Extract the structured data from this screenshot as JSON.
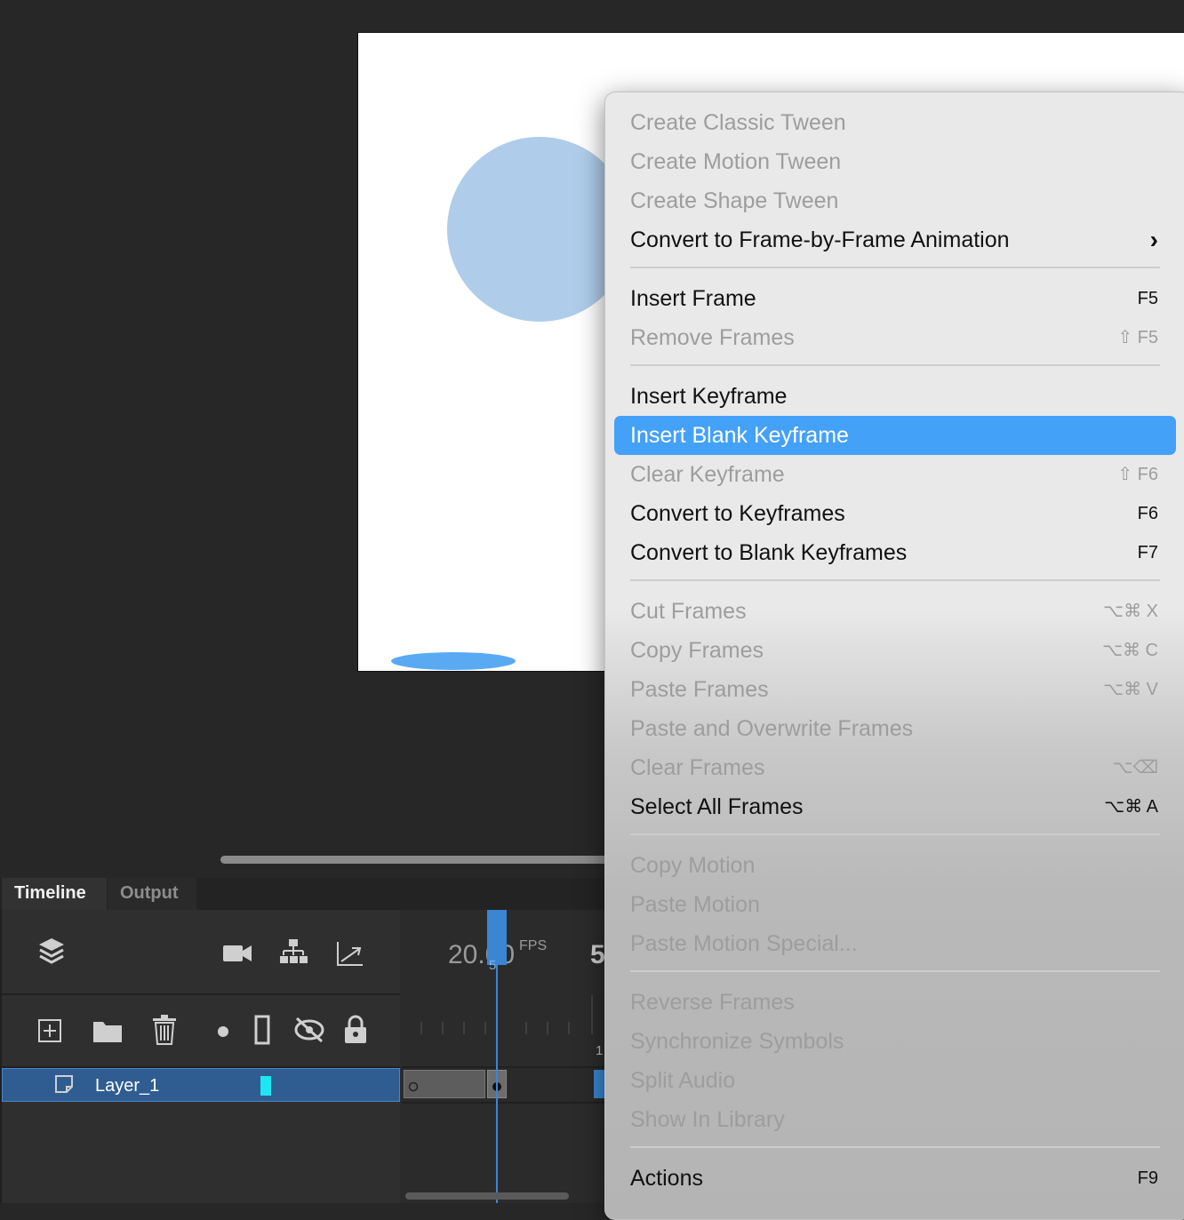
{
  "stage": {
    "shapes": [
      "circle",
      "ellipse"
    ],
    "circle_color": "#afcdea",
    "ellipse_color": "#5aa9f3"
  },
  "timeline": {
    "tabs": [
      {
        "label": "Timeline",
        "active": true
      },
      {
        "label": "Output",
        "active": false
      }
    ],
    "fps_value": "20.00",
    "fps_label": "FPS",
    "current_frame_partial": "5",
    "playhead_label": "5",
    "ruler_label": "1",
    "layers": [
      {
        "name": "Layer_1",
        "color": "#1de7f2"
      }
    ],
    "toolbar_icons": [
      "layers-icon",
      "camera-icon",
      "hierarchy-icon",
      "graph-icon"
    ],
    "layer_tools": [
      "new-layer-icon",
      "new-folder-icon",
      "trash-icon",
      "dot-icon",
      "outline-icon",
      "hide-icon",
      "lock-icon"
    ]
  },
  "menu": {
    "items": [
      {
        "label": "Create Classic Tween",
        "shortcut": "",
        "enabled": false
      },
      {
        "label": "Create Motion Tween",
        "shortcut": "",
        "enabled": false
      },
      {
        "label": "Create Shape Tween",
        "shortcut": "",
        "enabled": false
      },
      {
        "label": "Convert to Frame-by-Frame Animation",
        "shortcut": "",
        "enabled": true,
        "submenu": true
      },
      {
        "label": "Insert Frame",
        "shortcut": "F5",
        "enabled": true
      },
      {
        "label": "Remove Frames",
        "shortcut": "⇧ F5",
        "enabled": false
      },
      {
        "label": "Insert Keyframe",
        "shortcut": "",
        "enabled": true
      },
      {
        "label": "Insert Blank Keyframe",
        "shortcut": "",
        "enabled": true,
        "highlighted": true
      },
      {
        "label": "Clear Keyframe",
        "shortcut": "⇧ F6",
        "enabled": false
      },
      {
        "label": "Convert to Keyframes",
        "shortcut": "F6",
        "enabled": true
      },
      {
        "label": "Convert to Blank Keyframes",
        "shortcut": "F7",
        "enabled": true
      },
      {
        "label": "Cut Frames",
        "shortcut": "⌥⌘ X",
        "enabled": false
      },
      {
        "label": "Copy Frames",
        "shortcut": "⌥⌘ C",
        "enabled": false
      },
      {
        "label": "Paste Frames",
        "shortcut": "⌥⌘ V",
        "enabled": false
      },
      {
        "label": "Paste and Overwrite Frames",
        "shortcut": "",
        "enabled": false
      },
      {
        "label": "Clear Frames",
        "shortcut": "⌥⌫",
        "enabled": false
      },
      {
        "label": "Select All Frames",
        "shortcut": "⌥⌘ A",
        "enabled": true
      },
      {
        "label": "Copy Motion",
        "shortcut": "",
        "enabled": false
      },
      {
        "label": "Paste Motion",
        "shortcut": "",
        "enabled": false
      },
      {
        "label": "Paste Motion Special...",
        "shortcut": "",
        "enabled": false
      },
      {
        "label": "Reverse Frames",
        "shortcut": "",
        "enabled": false
      },
      {
        "label": "Synchronize Symbols",
        "shortcut": "",
        "enabled": false
      },
      {
        "label": "Split Audio",
        "shortcut": "",
        "enabled": false
      },
      {
        "label": "Show In Library",
        "shortcut": "",
        "enabled": false
      },
      {
        "label": "Actions",
        "shortcut": "F9",
        "enabled": true
      }
    ],
    "highlight_color": "#44a1f8"
  }
}
